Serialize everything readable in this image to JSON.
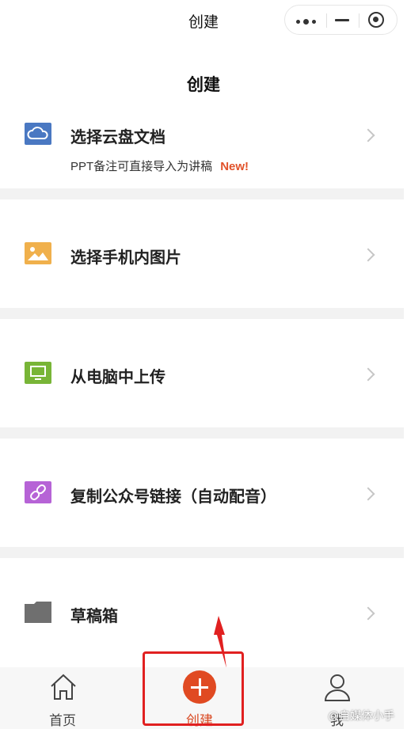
{
  "topbar": {
    "title": "创建",
    "icons": [
      "more-dots-icon",
      "minimize-icon",
      "target-icon"
    ]
  },
  "page": {
    "title": "创建"
  },
  "menu": {
    "items": [
      {
        "label": "选择云盘文档",
        "icon": "cloud-icon",
        "icon_color": "#4a78c2",
        "sub": "PPT备注可直接导入为讲稿",
        "badge": "New!",
        "badge_color": "#e1522a"
      },
      {
        "label": "选择手机内图片",
        "icon": "image-icon",
        "icon_color": "#f0b04c"
      },
      {
        "label": "从电脑中上传",
        "icon": "monitor-icon",
        "icon_color": "#78b537"
      },
      {
        "label": "复制公众号链接（自动配音）",
        "icon": "link-icon",
        "icon_color": "#b663d6"
      },
      {
        "label": "草稿箱",
        "icon": "folder-icon",
        "icon_color": "#6f6f6f"
      }
    ]
  },
  "tabbar": {
    "items": [
      {
        "label": "首页",
        "icon": "home-icon"
      },
      {
        "label": "创建",
        "icon": "plus-icon",
        "active": true,
        "color": "#e04a22"
      },
      {
        "label": "我",
        "icon": "user-icon"
      }
    ]
  },
  "annotation": {
    "highlight_color": "#e12020"
  },
  "watermark": "@自媒体小手"
}
